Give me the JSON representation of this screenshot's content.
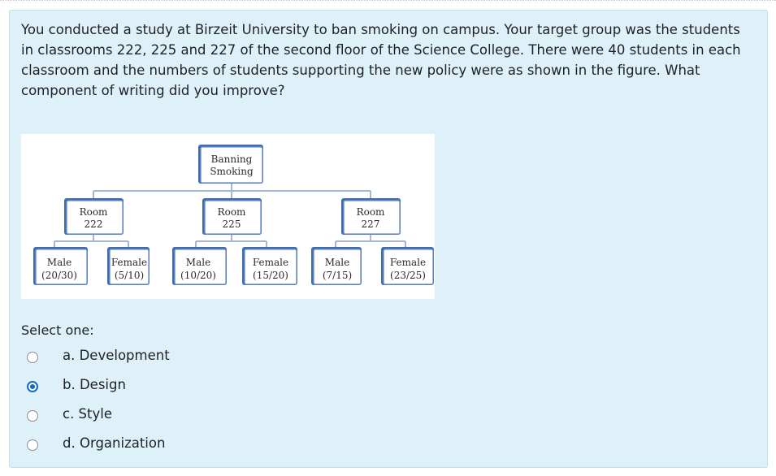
{
  "question": {
    "text": "You conducted a study at Birzeit University to ban smoking on campus. Your target group was the students in classrooms 222, 225 and 227 of the second floor of the Science College. There were 40 students in each classroom and the numbers of students supporting the new policy were as shown in the figure. What component of writing did you improve?"
  },
  "figure": {
    "root": [
      "Banning",
      "Smoking"
    ],
    "rooms": [
      {
        "line1": "Room",
        "line2": "222"
      },
      {
        "line1": "Room",
        "line2": "225"
      },
      {
        "line1": "Room",
        "line2": "227"
      }
    ],
    "leaves": [
      {
        "line1": "Male",
        "line2": "(20/30)"
      },
      {
        "line1": "Female",
        "line2": "(5/10)"
      },
      {
        "line1": "Male",
        "line2": "(10/20)"
      },
      {
        "line1": "Female",
        "line2": "(15/20)"
      },
      {
        "line1": "Male",
        "line2": "(7/15)"
      },
      {
        "line1": "Female",
        "line2": "(23/25)"
      }
    ]
  },
  "answers": {
    "prompt": "Select one:",
    "options": [
      {
        "label": "a. Development",
        "selected": false
      },
      {
        "label": "b. Design",
        "selected": true
      },
      {
        "label": "c. Style",
        "selected": false
      },
      {
        "label": "d. Organization",
        "selected": false
      }
    ]
  }
}
